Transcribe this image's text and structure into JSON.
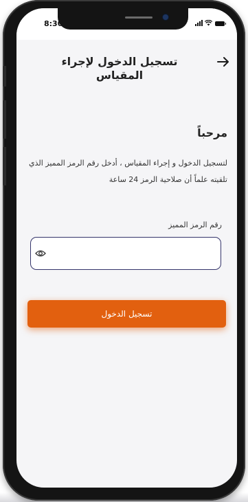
{
  "status_bar": {
    "time": "8:30",
    "icons": [
      "signal-icon",
      "wifi-icon",
      "battery-icon"
    ]
  },
  "header": {
    "back_icon": "arrow-right-icon",
    "title": "تسجيل الدخول لإجراء المقياس"
  },
  "content": {
    "welcome": "مرحباً",
    "instructions": "لتسجيل الدخول و إجراء المقياس ، أدخل رقم الرمز المميز الذي تلقيته علماً أن صلاحية الرمز 24 ساعة"
  },
  "token_field": {
    "label": "رقم الرمز المميز",
    "value": "",
    "placeholder": "",
    "toggle_icon": "eye-icon"
  },
  "login_button": {
    "label": "تسجيل الدخول"
  },
  "colors": {
    "accent": "#e2600f",
    "input_border": "#34346a",
    "background": "#f5f5f7"
  }
}
